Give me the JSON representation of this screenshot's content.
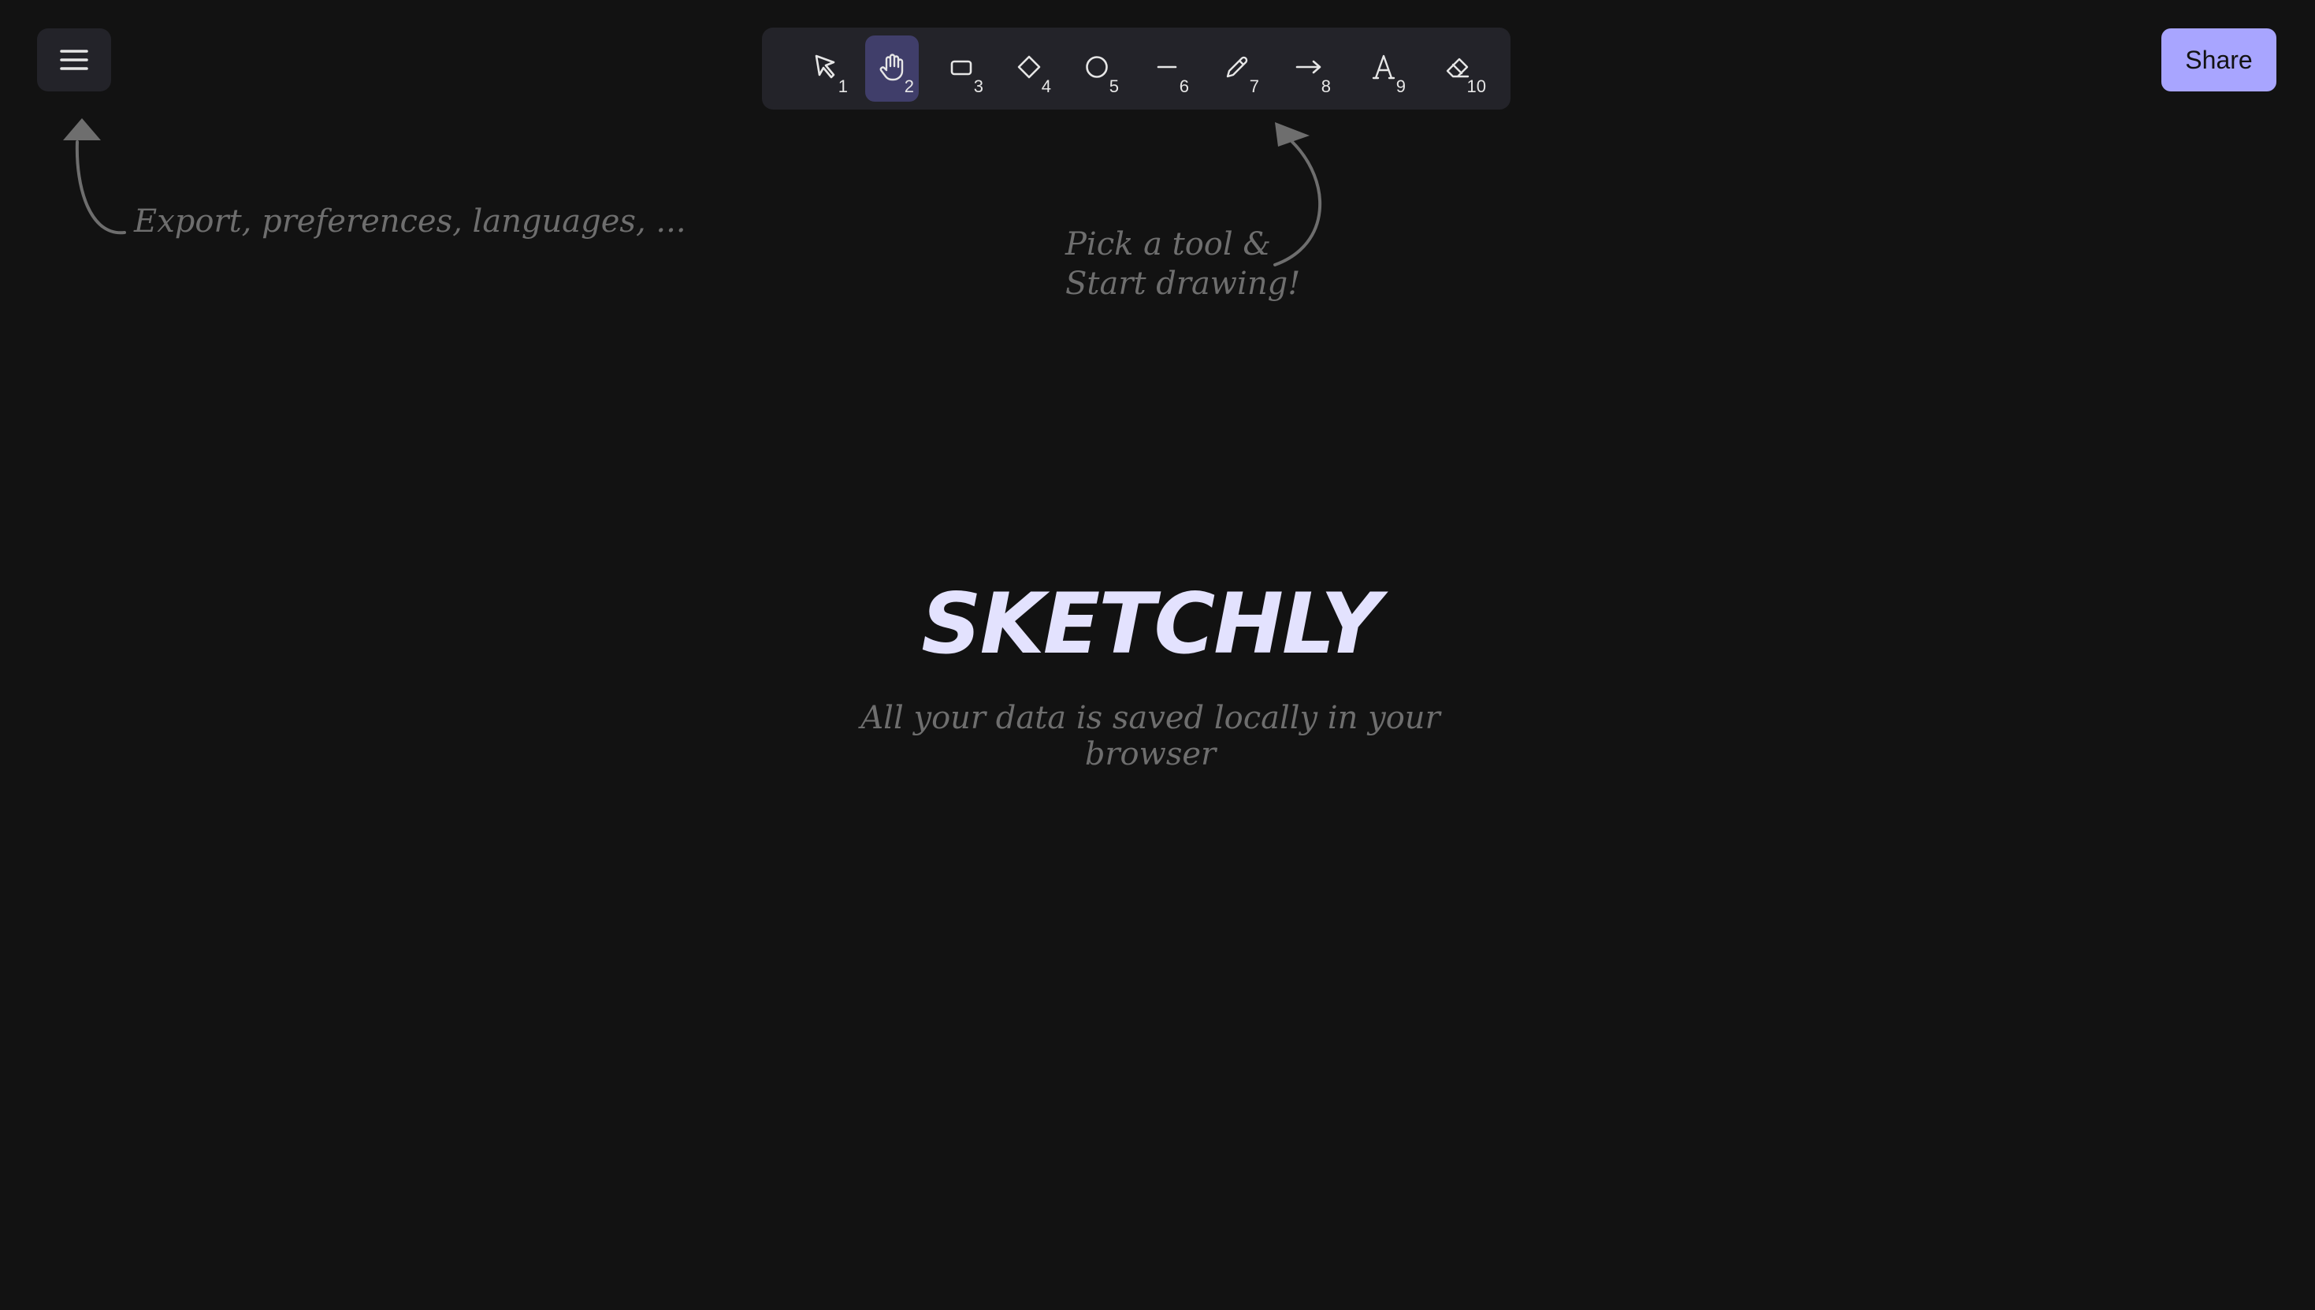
{
  "menu": {
    "icon": "hamburger-menu-icon"
  },
  "toolbar": {
    "active_tool": "2",
    "tools": [
      {
        "name": "selection",
        "icon": "pointer-icon",
        "key": "1"
      },
      {
        "name": "hand",
        "icon": "hand-icon",
        "key": "2"
      },
      {
        "name": "rectangle",
        "icon": "rectangle-icon",
        "key": "3"
      },
      {
        "name": "diamond",
        "icon": "diamond-icon",
        "key": "4"
      },
      {
        "name": "ellipse",
        "icon": "ellipse-icon",
        "key": "5"
      },
      {
        "name": "line",
        "icon": "line-icon",
        "key": "6"
      },
      {
        "name": "draw",
        "icon": "pencil-icon",
        "key": "7"
      },
      {
        "name": "arrow",
        "icon": "arrow-icon",
        "key": "8"
      },
      {
        "name": "text",
        "icon": "text-icon",
        "key": "9"
      },
      {
        "name": "eraser",
        "icon": "eraser-icon",
        "key": "10"
      }
    ]
  },
  "share": {
    "label": "Share"
  },
  "hints": {
    "menu": "Export, preferences, languages, ...",
    "tools_line1": "Pick a tool &",
    "tools_line2": "Start drawing!"
  },
  "welcome": {
    "title": "SKETCHLY",
    "subtitle": "All your data is saved locally in your browser"
  },
  "colors": {
    "background": "#121212",
    "panel": "#232329",
    "active_tool": "#403e6a",
    "accent": "#a8a5ff",
    "title": "#e3e2fe",
    "hint": "#6e6e6e"
  }
}
